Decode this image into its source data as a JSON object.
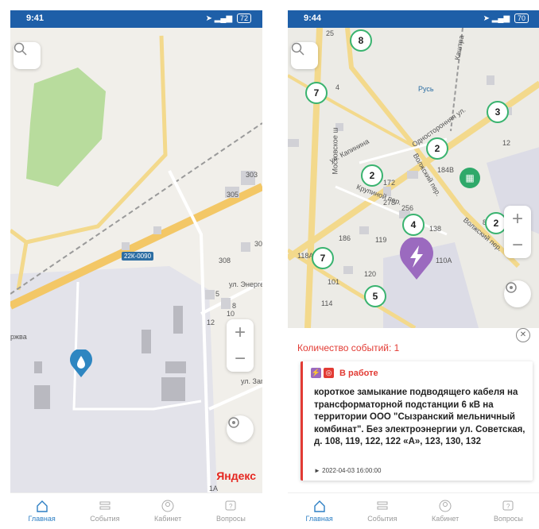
{
  "left_screen": {
    "status_time": "9:41",
    "battery": "72",
    "map": {
      "road_code": "22К-0090",
      "labels": [
        "ул. Энергет",
        "ул. Запад",
        "ржва"
      ],
      "building_numbers": [
        "303",
        "305",
        "308",
        "5",
        "6",
        "8",
        "10",
        "12",
        "1A",
        "30"
      ],
      "attribution": "Яндекс"
    }
  },
  "right_screen": {
    "status_time": "9:44",
    "battery": "70",
    "map": {
      "clusters": [
        "8",
        "7",
        "2",
        "2",
        "3",
        "4",
        "2",
        "7",
        "5"
      ],
      "labels": [
        "ул. Капинина",
        "Московское ш",
        "Волжский пер.",
        "Крупиной пер.",
        "Односторонняя ул.",
        "Каштра",
        "Русь",
        "Волжский пер."
      ],
      "building_numbers": [
        "25",
        "184В",
        "172",
        "278",
        "256",
        "186",
        "119",
        "138",
        "110A",
        "118A",
        "101",
        "120",
        "114",
        "8A",
        "12",
        "4"
      ]
    },
    "panel": {
      "events_count_label": "Количество событий: 1",
      "close_glyph": "✕",
      "card": {
        "status": "В работе",
        "text": "короткое замыкание подводящего кабеля на трансформаторной подстанции  6 кВ на территории ООО \"Сызранский мельничный комбинат\". Без электроэнергии ул. Советская, д. 108, 119, 122, 122 «А», 123, 130, 132",
        "date": "► 2022-04-03 16:00:00"
      }
    }
  },
  "tabbar": {
    "tabs": [
      {
        "label": "Главная",
        "icon": "home-icon"
      },
      {
        "label": "События",
        "icon": "list-icon"
      },
      {
        "label": "Кабинет",
        "icon": "user-icon"
      },
      {
        "label": "Вопросы",
        "icon": "question-icon"
      }
    ]
  },
  "colors": {
    "statusbar": "#1e5fa8",
    "accent": "#2d7fc4",
    "alert": "#e23b34",
    "cluster_ring": "#39b36f",
    "event_pin": "#9b6abf",
    "water_pin": "#2e86c1"
  }
}
